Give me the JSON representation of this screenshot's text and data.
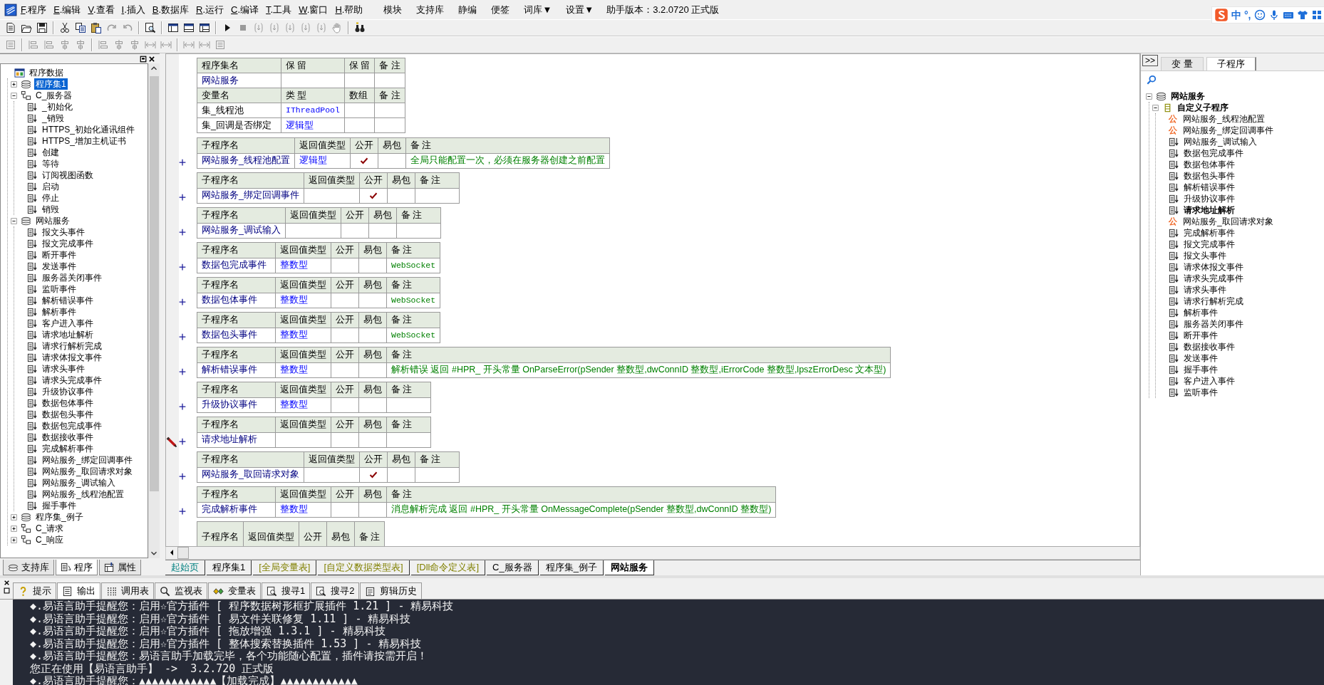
{
  "menu_bar": {
    "menus": [
      {
        "key": "F",
        "rest": ".程序"
      },
      {
        "key": "E",
        "rest": ".编辑"
      },
      {
        "key": "V",
        "rest": ".查看"
      },
      {
        "key": "I",
        "rest": ".插入"
      },
      {
        "key": "B",
        "rest": ".数据库"
      },
      {
        "key": "R",
        "rest": ".运行"
      },
      {
        "key": "C",
        "rest": ".编译"
      },
      {
        "key": "T",
        "rest": ".工具"
      },
      {
        "key": "W",
        "rest": ".窗口"
      },
      {
        "key": "H",
        "rest": ".帮助"
      }
    ],
    "extras": [
      "模块",
      "支持库",
      "静编",
      "便签",
      "词库▼",
      "设置▼"
    ],
    "version": "助手版本：3.2.0720 正式版"
  },
  "ime": {
    "mode": "中",
    "punct": "°,"
  },
  "left_panel": {
    "tree": [
      {
        "label": "程序数据",
        "kind": "root",
        "selected": false,
        "children": [
          {
            "label": "程序集1",
            "kind": "assembly",
            "expanded": false,
            "selected": true
          },
          {
            "label": "C_服务器",
            "kind": "class",
            "expanded": true,
            "selected": false,
            "children": [
              {
                "label": "_初始化",
                "kind": "sub",
                "selected": false
              },
              {
                "label": "_销毁",
                "kind": "sub",
                "selected": false
              },
              {
                "label": "HTTPS_初始化通讯组件",
                "kind": "sub",
                "selected": false
              },
              {
                "label": "HTTPS_增加主机证书",
                "kind": "sub",
                "selected": false
              },
              {
                "label": "创建",
                "kind": "sub",
                "selected": false
              },
              {
                "label": "等待",
                "kind": "sub",
                "selected": false
              },
              {
                "label": "订阅视图函数",
                "kind": "sub",
                "selected": false
              },
              {
                "label": "启动",
                "kind": "sub",
                "selected": false
              },
              {
                "label": "停止",
                "kind": "sub",
                "selected": false
              },
              {
                "label": "销毁",
                "kind": "sub",
                "selected": false
              }
            ]
          },
          {
            "label": "网站服务",
            "kind": "assembly",
            "expanded": true,
            "selected": false,
            "children": [
              {
                "label": "报文头事件",
                "kind": "sub",
                "selected": false
              },
              {
                "label": "报文完成事件",
                "kind": "sub",
                "selected": false
              },
              {
                "label": "断开事件",
                "kind": "sub",
                "selected": false
              },
              {
                "label": "发送事件",
                "kind": "sub",
                "selected": false
              },
              {
                "label": "服务器关闭事件",
                "kind": "sub",
                "selected": false
              },
              {
                "label": "监听事件",
                "kind": "sub",
                "selected": false
              },
              {
                "label": "解析错误事件",
                "kind": "sub",
                "selected": false
              },
              {
                "label": "解析事件",
                "kind": "sub",
                "selected": false
              },
              {
                "label": "客户进入事件",
                "kind": "sub",
                "selected": false
              },
              {
                "label": "请求地址解析",
                "kind": "sub",
                "selected": false
              },
              {
                "label": "请求行解析完成",
                "kind": "sub",
                "selected": false
              },
              {
                "label": "请求体报文事件",
                "kind": "sub",
                "selected": false
              },
              {
                "label": "请求头事件",
                "kind": "sub",
                "selected": false
              },
              {
                "label": "请求头完成事件",
                "kind": "sub",
                "selected": false
              },
              {
                "label": "升级协议事件",
                "kind": "sub",
                "selected": false
              },
              {
                "label": "数据包体事件",
                "kind": "sub",
                "selected": false
              },
              {
                "label": "数据包头事件",
                "kind": "sub",
                "selected": false
              },
              {
                "label": "数据包完成事件",
                "kind": "sub",
                "selected": false
              },
              {
                "label": "数据接收事件",
                "kind": "sub",
                "selected": false
              },
              {
                "label": "完成解析事件",
                "kind": "sub",
                "selected": false
              },
              {
                "label": "网站服务_绑定回调事件",
                "kind": "sub",
                "selected": false
              },
              {
                "label": "网站服务_取回请求对象",
                "kind": "sub",
                "selected": false
              },
              {
                "label": "网站服务_调试输入",
                "kind": "sub",
                "selected": false
              },
              {
                "label": "网站服务_线程池配置",
                "kind": "sub",
                "selected": false
              },
              {
                "label": "握手事件",
                "kind": "sub",
                "selected": false
              }
            ]
          },
          {
            "label": "程序集_例子",
            "kind": "assembly",
            "expanded": false,
            "selected": false
          },
          {
            "label": "C_请求",
            "kind": "class",
            "expanded": false,
            "selected": false
          },
          {
            "label": "C_响应",
            "kind": "class",
            "expanded": false,
            "selected": false
          }
        ]
      }
    ],
    "tabs": [
      {
        "label": "支持库",
        "kind": "library",
        "selected": false
      },
      {
        "label": "程序",
        "kind": "program",
        "selected": true
      },
      {
        "label": "属性",
        "kind": "property",
        "selected": false
      }
    ]
  },
  "editor": {
    "assembly_table": {
      "header": [
        "程序集名",
        "保 留",
        "保 留",
        "备 注"
      ],
      "name": "网站服务",
      "var_header": [
        "变量名",
        "类 型",
        "数组",
        "备 注"
      ],
      "variables": [
        {
          "name": "集_线程池",
          "type": "IThreadPool"
        },
        {
          "name": "集_回调是否绑定",
          "type": "逻辑型"
        }
      ]
    },
    "subroutines": [
      {
        "header": [
          "子程序名",
          "返回值类型",
          "公开",
          "易包",
          "备 注"
        ],
        "name": "网站服务_线程池配置",
        "return_type": "逻辑型",
        "public": true,
        "marked": false,
        "remark": "全局只能配置一次，必须在服务器创建之前配置"
      },
      {
        "header": [
          "子程序名",
          "返回值类型",
          "公开",
          "易包",
          "备 注"
        ],
        "name": "网站服务_绑定回调事件",
        "public": true,
        "marked": false
      },
      {
        "header": [
          "子程序名",
          "返回值类型",
          "公开",
          "易包",
          "备 注"
        ],
        "name": "网站服务_调试输入",
        "public": false,
        "marked": false
      },
      {
        "header": [
          "子程序名",
          "返回值类型",
          "公开",
          "易包",
          "备 注"
        ],
        "name": "数据包完成事件",
        "return_type": "整数型",
        "public": false,
        "marked": false,
        "remark": "WebSocket"
      },
      {
        "header": [
          "子程序名",
          "返回值类型",
          "公开",
          "易包",
          "备 注"
        ],
        "name": "数据包体事件",
        "return_type": "整数型",
        "public": false,
        "marked": false,
        "remark": "WebSocket"
      },
      {
        "header": [
          "子程序名",
          "返回值类型",
          "公开",
          "易包",
          "备 注"
        ],
        "name": "数据包头事件",
        "return_type": "整数型",
        "public": false,
        "marked": false,
        "remark": "WebSocket"
      },
      {
        "header": [
          "子程序名",
          "返回值类型",
          "公开",
          "易包",
          "备 注"
        ],
        "name": "解析错误事件",
        "return_type": "整数型",
        "public": false,
        "marked": false,
        "remark": "解析错误 返回 #HPR_ 开头常量 OnParseError(pSender 整数型,dwConnID 整数型,iErrorCode 整数型,lpszErrorDesc 文本型)"
      },
      {
        "header": [
          "子程序名",
          "返回值类型",
          "公开",
          "易包",
          "备 注"
        ],
        "name": "升级协议事件",
        "return_type": "整数型",
        "public": false,
        "marked": false
      },
      {
        "header": [
          "子程序名",
          "返回值类型",
          "公开",
          "易包",
          "备 注"
        ],
        "name": "请求地址解析",
        "public": false,
        "marked": true
      },
      {
        "header": [
          "子程序名",
          "返回值类型",
          "公开",
          "易包",
          "备 注"
        ],
        "name": "网站服务_取回请求对象",
        "public": true,
        "marked": false
      },
      {
        "header": [
          "子程序名",
          "返回值类型",
          "公开",
          "易包",
          "备 注"
        ],
        "name": "完成解析事件",
        "return_type": "整数型",
        "public": false,
        "marked": false,
        "remark": "消息解析完成  返回 #HPR_ 开头常量 OnMessageComplete(pSender 整数型,dwConnID 整数型)"
      },
      {
        "header": [
          "子程序名",
          "返回值类型",
          "公开",
          "易包",
          "备 注"
        ]
      }
    ],
    "tabs": [
      {
        "label": "起始页",
        "kind": "start",
        "selected": false
      },
      {
        "label": "程序集1",
        "kind": "source",
        "selected": false
      },
      {
        "label": "[全局变量表]",
        "kind": "table",
        "selected": false
      },
      {
        "label": "[自定义数据类型表]",
        "kind": "table",
        "selected": false
      },
      {
        "label": "[Dll命令定义表]",
        "kind": "table",
        "selected": false
      },
      {
        "label": "C_服务器",
        "kind": "source",
        "selected": false
      },
      {
        "label": "程序集_例子",
        "kind": "source",
        "selected": false
      },
      {
        "label": "网站服务",
        "kind": "source",
        "selected": true
      }
    ]
  },
  "right_panel": {
    "collapse_button": ">>",
    "tabs": [
      {
        "label": "变 量",
        "selected": false
      },
      {
        "label": "子程序",
        "selected": true
      }
    ],
    "tree": [
      {
        "label": "网站服务",
        "kind": "assembly",
        "expanded": true,
        "active": true,
        "children": [
          {
            "label": "自定义子程序",
            "kind": "group",
            "expanded": true,
            "active": true,
            "children": [
              {
                "label": "网站服务_线程池配置",
                "kind": "public",
                "icon_text": "公",
                "active": false
              },
              {
                "label": "网站服务_绑定回调事件",
                "kind": "public",
                "icon_text": "公",
                "active": false
              },
              {
                "label": "网站服务_调试输入",
                "kind": "sub",
                "active": false
              },
              {
                "label": "数据包完成事件",
                "kind": "sub",
                "active": false
              },
              {
                "label": "数据包体事件",
                "kind": "sub",
                "active": false
              },
              {
                "label": "数据包头事件",
                "kind": "sub",
                "active": false
              },
              {
                "label": "解析错误事件",
                "kind": "sub",
                "active": false
              },
              {
                "label": "升级协议事件",
                "kind": "sub",
                "active": false
              },
              {
                "label": "请求地址解析",
                "kind": "sub",
                "active": true
              },
              {
                "label": "网站服务_取回请求对象",
                "kind": "public",
                "icon_text": "公",
                "active": false
              },
              {
                "label": "完成解析事件",
                "kind": "sub",
                "active": false
              },
              {
                "label": "报文完成事件",
                "kind": "sub",
                "active": false
              },
              {
                "label": "报文头事件",
                "kind": "sub",
                "active": false
              },
              {
                "label": "请求体报文事件",
                "kind": "sub",
                "active": false
              },
              {
                "label": "请求头完成事件",
                "kind": "sub",
                "active": false
              },
              {
                "label": "请求头事件",
                "kind": "sub",
                "active": false
              },
              {
                "label": "请求行解析完成",
                "kind": "sub",
                "active": false
              },
              {
                "label": "解析事件",
                "kind": "sub",
                "active": false
              },
              {
                "label": "服务器关闭事件",
                "kind": "sub",
                "active": false
              },
              {
                "label": "断开事件",
                "kind": "sub",
                "active": false
              },
              {
                "label": "数据接收事件",
                "kind": "sub",
                "active": false
              },
              {
                "label": "发送事件",
                "kind": "sub",
                "active": false
              },
              {
                "label": "握手事件",
                "kind": "sub",
                "active": false
              },
              {
                "label": "客户进入事件",
                "kind": "sub",
                "active": false
              },
              {
                "label": "监听事件",
                "kind": "sub",
                "active": false
              }
            ]
          }
        ]
      }
    ]
  },
  "output_panel": {
    "tabs": [
      {
        "label": "提示",
        "kind": "hint",
        "selected": false
      },
      {
        "label": "输出",
        "kind": "output",
        "selected": true
      },
      {
        "label": "调用表",
        "kind": "calls",
        "selected": false
      },
      {
        "label": "监视表",
        "kind": "watch",
        "selected": false
      },
      {
        "label": "变量表",
        "kind": "vars",
        "selected": false
      },
      {
        "label": "搜寻1",
        "kind": "search",
        "selected": false
      },
      {
        "label": "搜寻2",
        "kind": "search",
        "selected": false
      },
      {
        "label": "剪辑历史",
        "kind": "clip",
        "selected": false
      }
    ],
    "lines": [
      "◆.易语言助手提醒您：启用☆官方插件 [ 程序数据树形框扩展插件 1.21 ] - 精易科技",
      "◆.易语言助手提醒您：启用☆官方插件 [ 易文件关联修复 1.11 ] - 精易科技",
      "◆.易语言助手提醒您：启用☆官方插件 [ 拖放增强 1.3.1 ] - 精易科技",
      "◆.易语言助手提醒您：启用☆官方插件 [ 整体搜索替换插件 1.53 ] - 精易科技",
      "◆.易语言助手提醒您：易语言助手加载完毕，各个功能随心配置，插件请按需开启！",
      "您正在使用【易语言助手】 ->  3.2.720 正式版",
      "◆.易语言助手提醒您：▲▲▲▲▲▲▲▲▲▲▲▲【加载完成】▲▲▲▲▲▲▲▲▲▲▲▲"
    ]
  }
}
